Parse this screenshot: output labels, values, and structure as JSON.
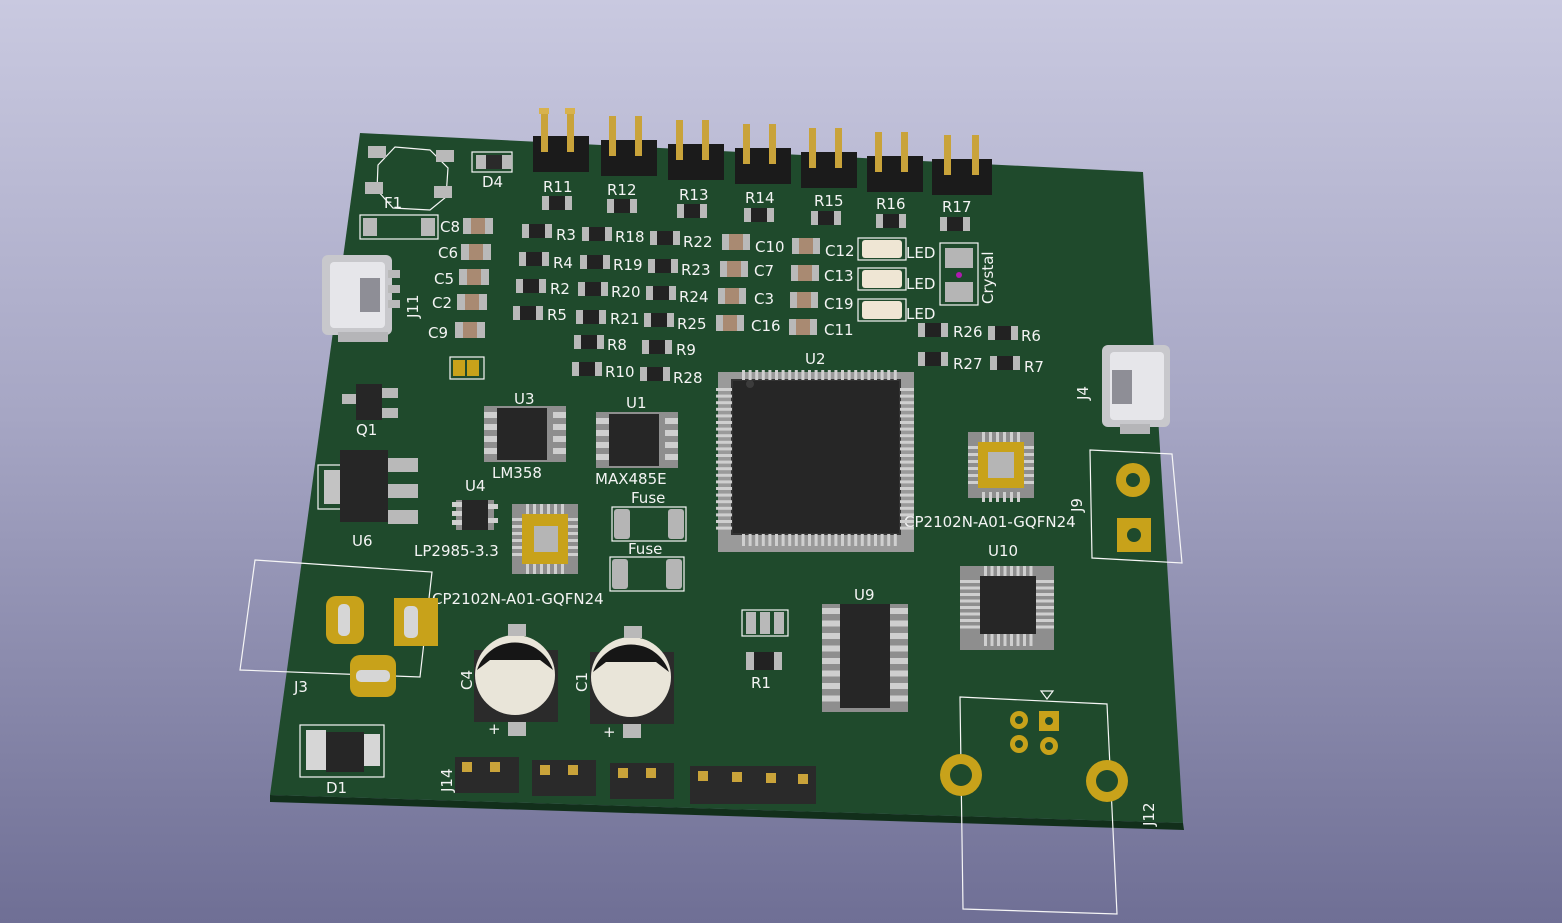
{
  "labels": {
    "F1": "F1",
    "D4": "D4",
    "C8": "C8",
    "C6": "C6",
    "C5": "C5",
    "C2": "C2",
    "C9": "C9",
    "J11": "J11",
    "R11": "R11",
    "R12": "R12",
    "R13": "R13",
    "R14": "R14",
    "R15": "R15",
    "R16": "R16",
    "R17": "R17",
    "R3": "R3",
    "R4": "R4",
    "R2": "R2",
    "R5": "R5",
    "R18": "R18",
    "R19": "R19",
    "R20": "R20",
    "R21": "R21",
    "R22": "R22",
    "R23": "R23",
    "R24": "R24",
    "R25": "R25",
    "C10": "C10",
    "C7": "C7",
    "C3": "C3",
    "C16": "C16",
    "C12": "C12",
    "C13": "C13",
    "C19": "C19",
    "C11": "C11",
    "LED1": "LED",
    "LED2": "LED",
    "LED3": "LED",
    "Crystal": "Crystal",
    "R26": "R26",
    "R6": "R6",
    "R27": "R27",
    "R7": "R7",
    "R8": "R8",
    "R9": "R9",
    "R10": "R10",
    "R28": "R28",
    "U2": "U2",
    "U3": "U3",
    "U1": "U1",
    "LM358": "LM358",
    "MAX485E": "MAX485E",
    "Q1": "Q1",
    "U6": "U6",
    "U4": "U4",
    "LP2985": "LP2985-3.3",
    "Fuse1": "Fuse",
    "Fuse2": "Fuse",
    "CP2102_1": "CP2102N-A01-GQFN24",
    "CP2102_2": "CP2102N-A01-GQFN24",
    "J4": "J4",
    "J9": "J9",
    "U10": "U10",
    "U9": "U9",
    "R1": "R1",
    "J3": "J3",
    "C4": "C4",
    "C1": "C1",
    "D1": "D1",
    "J14": "J14",
    "J12": "J12",
    "plus": "+"
  },
  "colors": {
    "pcb": "#1f4a2c",
    "pcb_edge": "#153620",
    "silkscreen": "#f4f4f4",
    "pad_gold": "#c8a21a",
    "pad_silver": "#b9b9b9"
  }
}
